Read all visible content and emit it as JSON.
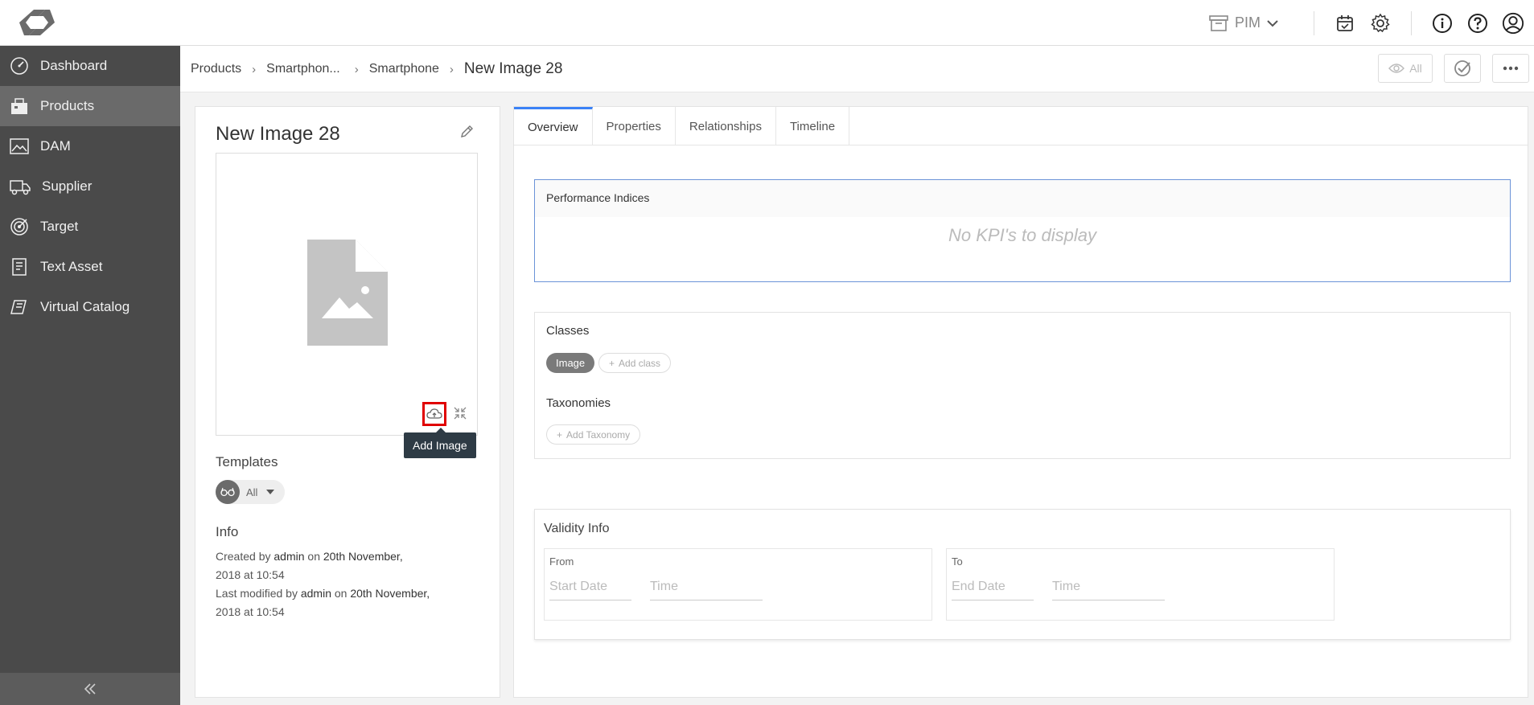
{
  "topbar": {
    "module_label": "PIM",
    "icons": [
      "archive-icon",
      "chevron-down-icon",
      "calendar-icon",
      "gear-icon",
      "info-icon",
      "help-icon",
      "user-avatar-icon"
    ]
  },
  "sidebar": {
    "items": [
      {
        "label": "Dashboard",
        "icon": "dashboard-icon",
        "active": false
      },
      {
        "label": "Products",
        "icon": "products-icon",
        "active": true
      },
      {
        "label": "DAM",
        "icon": "image-icon",
        "active": false
      },
      {
        "label": "Supplier",
        "icon": "truck-icon",
        "active": false
      },
      {
        "label": "Target",
        "icon": "target-icon",
        "active": false
      },
      {
        "label": "Text Asset",
        "icon": "document-icon",
        "active": false
      },
      {
        "label": "Virtual Catalog",
        "icon": "catalog-icon",
        "active": false
      }
    ]
  },
  "breadcrumb": {
    "items": [
      "Products",
      "Smartphon...",
      "Smartphone"
    ],
    "current": "New Image 28",
    "view_all_label": "All"
  },
  "entity": {
    "title": "New Image 28",
    "tooltip": "Add Image",
    "templates_label": "Templates",
    "template_value": "All",
    "info_label": "Info",
    "created_prefix": "Created by",
    "created_by": "admin",
    "created_on_word": "on",
    "created_date": "20th November,",
    "created_rest": "2018 at 10:54",
    "modified_prefix": "Last modified by",
    "modified_by": "admin",
    "modified_on_word": "on",
    "modified_date": "20th November,",
    "modified_rest": "2018 at 10:54"
  },
  "tabs": [
    "Overview",
    "Properties",
    "Relationships",
    "Timeline"
  ],
  "performance": {
    "title": "Performance Indices",
    "empty_text": "No KPI's to display"
  },
  "classes": {
    "title": "Classes",
    "chip": "Image",
    "add_class": "Add class",
    "taxonomies_title": "Taxonomies",
    "add_taxonomy": "Add Taxonomy"
  },
  "validity": {
    "title": "Validity Info",
    "from_label": "From",
    "to_label": "To",
    "start_date_placeholder": "Start Date",
    "end_date_placeholder": "End Date",
    "time_placeholder": "Time"
  }
}
